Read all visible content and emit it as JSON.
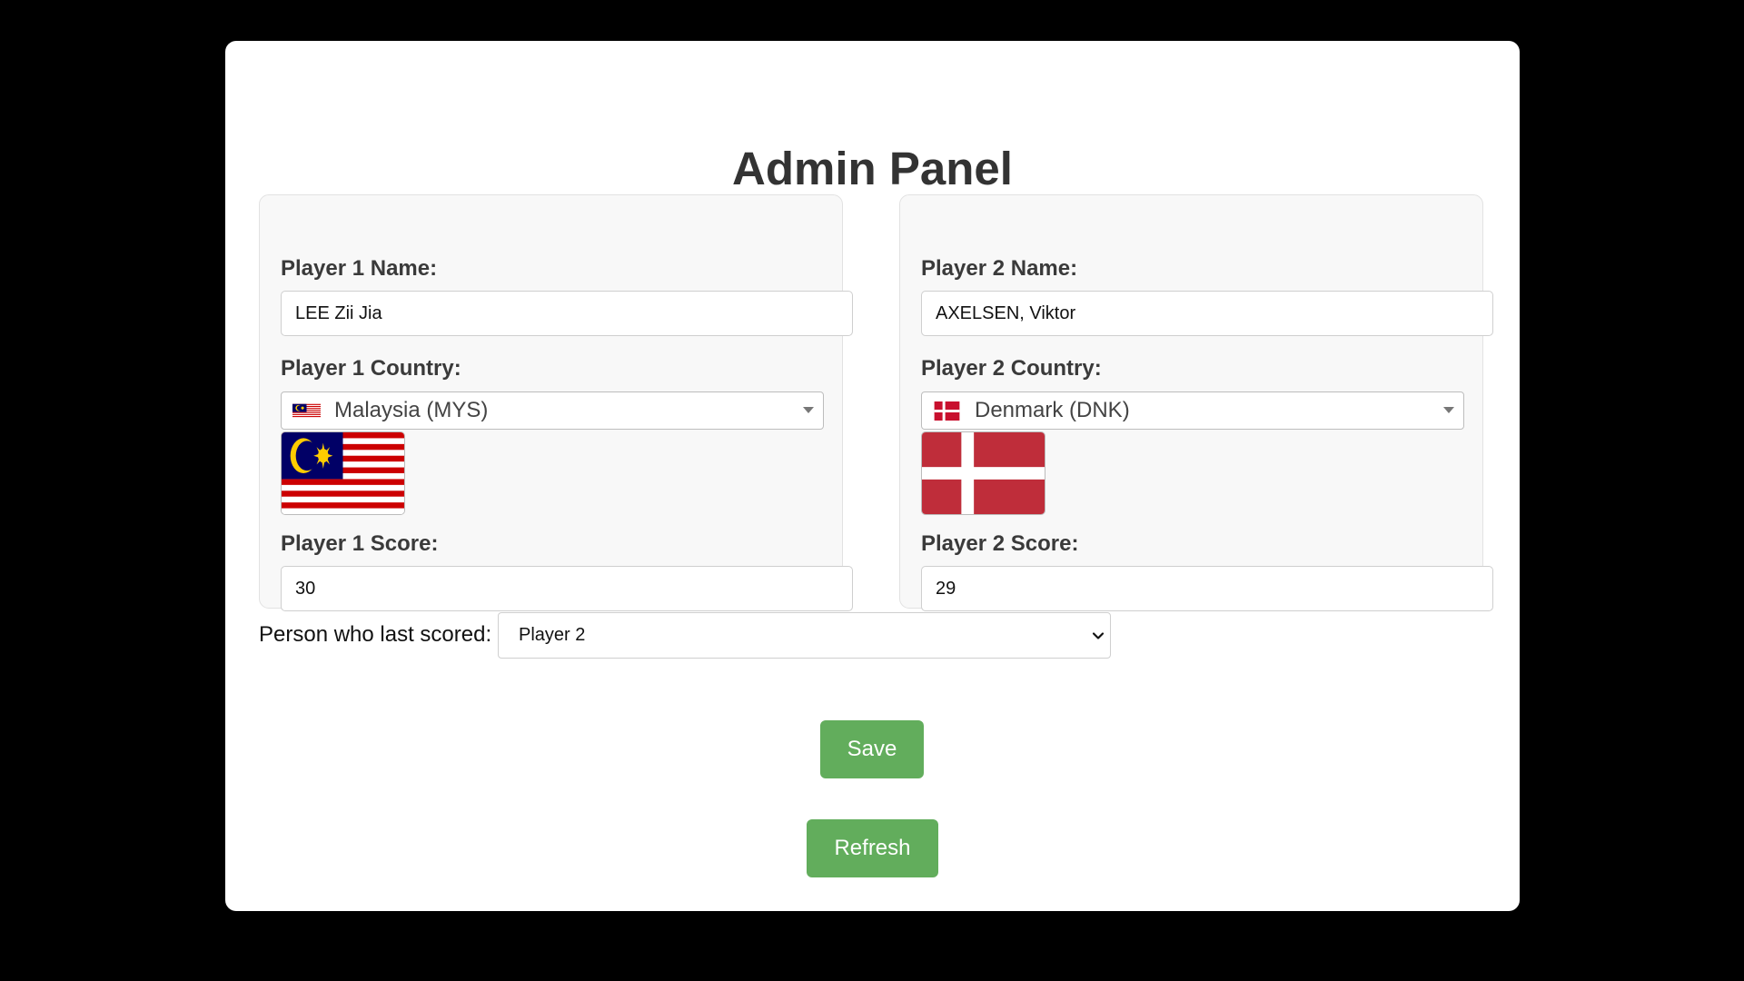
{
  "page": {
    "title": "Admin Panel"
  },
  "player1": {
    "name_label": "Player 1 Name:",
    "name_value": "LEE Zii Jia",
    "country_label": "Player 1 Country:",
    "country_value": "Malaysia (MYS)",
    "flag_icon": "malaysia-flag-icon",
    "score_label": "Player 1 Score:",
    "score_value": "30"
  },
  "player2": {
    "name_label": "Player 2 Name:",
    "name_value": "AXELSEN, Viktor",
    "country_label": "Player 2 Country:",
    "country_value": "Denmark (DNK)",
    "flag_icon": "denmark-flag-icon",
    "score_label": "Player 2 Score:",
    "score_value": "29"
  },
  "last_scored": {
    "label": "Person who last scored:",
    "selected": "Player 2"
  },
  "buttons": {
    "save": "Save",
    "refresh": "Refresh"
  },
  "colors": {
    "background": "#000000",
    "panel": "#ffffff",
    "card": "#f8f8f8",
    "button": "#62ad5c",
    "title": "#333333"
  }
}
